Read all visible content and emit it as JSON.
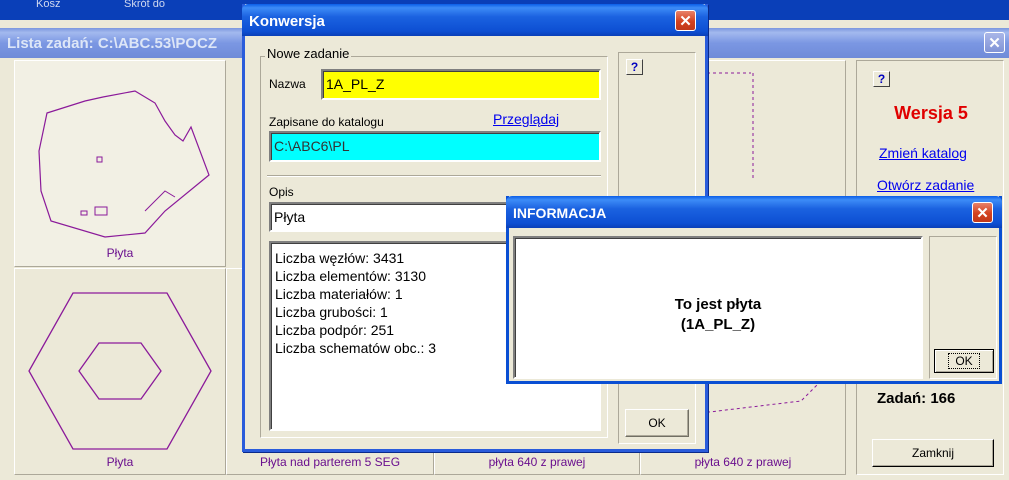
{
  "background_window": {
    "menu_text": [
      "Kosz",
      "Skrót do"
    ],
    "title": "Lista zadań: C:\\ABC.53\\POCZ",
    "close_label": "✕",
    "thumbnails": [
      {
        "label": "Płyta"
      },
      {
        "label": "Płyta"
      },
      {
        "label": "Płyta nad parterem 5 SEG"
      },
      {
        "label": "płyta 640 z prawej"
      },
      {
        "label": "płyta 640 z prawej"
      }
    ],
    "side_panel": {
      "help": "?",
      "version": "Wersja 5",
      "change_dir": "Zmień katalog",
      "open_task": "Otwórz zadanie",
      "count": "Zadań: 166",
      "close_btn": "Zamknij"
    }
  },
  "konwersja": {
    "title": "Konwersja",
    "close_label": "✕",
    "group_label": "Nowe zadanie",
    "name_label": "Nazwa",
    "name_value": "1A_PL_Z",
    "dir_label": "Zapisane do katalogu",
    "browse_link": "Przeglądaj",
    "dir_value": "C:\\ABC6\\PL",
    "desc_label": "Opis",
    "desc_value": "Płyta",
    "stats": [
      "Liczba węzłów: 3431",
      "Liczba elementów: 3130",
      "Liczba materiałów: 1",
      "Liczba grubości: 1",
      "Liczba podpór: 251",
      "Liczba schematów obc.: 3"
    ],
    "help": "?",
    "ok": "OK"
  },
  "informacja": {
    "title": "INFORMACJA",
    "close_label": "✕",
    "message_line1": "To jest płyta",
    "message_line2": "(1A_PL_Z)",
    "ok": "OK"
  },
  "colors": {
    "name_field": "#ffff00",
    "dir_field": "#00ffff",
    "version_red": "#e00000",
    "outline_purple": "#8b1a9a"
  }
}
